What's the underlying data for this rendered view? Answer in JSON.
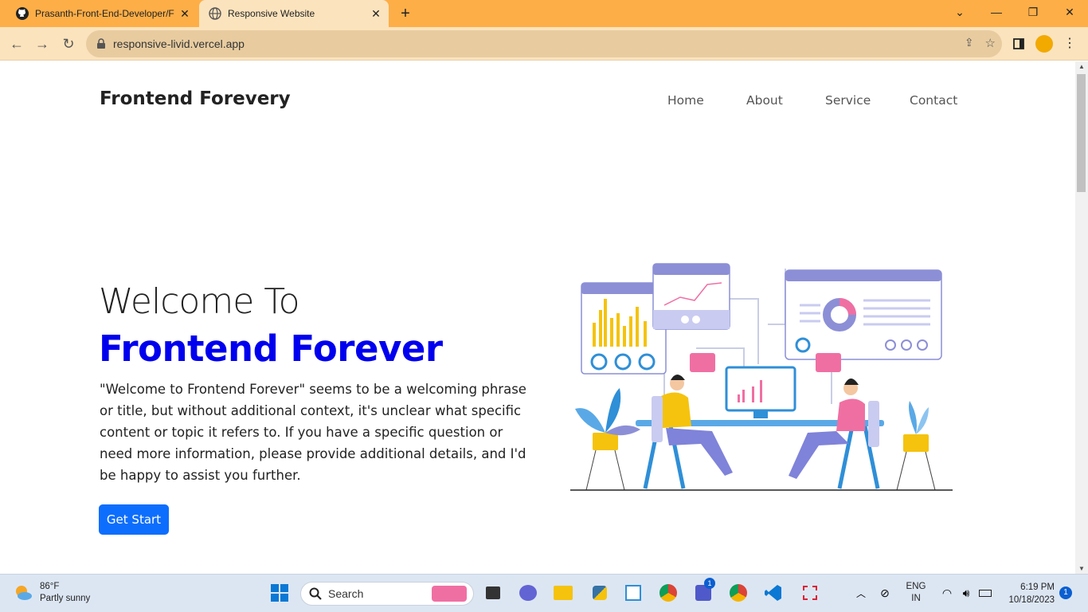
{
  "browser": {
    "tabs": [
      {
        "label": "Prasanth-Front-End-Developer/F",
        "icon": "github-icon",
        "active": false
      },
      {
        "label": "Responsive Website",
        "icon": "globe-icon",
        "active": true
      }
    ],
    "url": "responsive-livid.vercel.app"
  },
  "site": {
    "brand": "Frontend Forevery",
    "nav": [
      "Home",
      "About",
      "Service",
      "Contact"
    ],
    "hero": {
      "title_line1": "Welcome To",
      "title_line2": "Frontend Forever",
      "paragraph": "\"Welcome to Frontend Forever\" seems to be a welcoming phrase or title, but without additional context, it's unclear what specific content or topic it refers to. If you have a specific question or need more information, please provide additional details, and I'd be happy to assist you further.",
      "button": "Get Start"
    }
  },
  "taskbar": {
    "weather": {
      "temp": "86°F",
      "desc": "Partly sunny"
    },
    "search_placeholder": "Search",
    "language": {
      "line1": "ENG",
      "line2": "IN"
    },
    "time": "6:19 PM",
    "date": "10/18/2023",
    "notification_count": "1",
    "teams_badge": "1"
  },
  "colors": {
    "tabbar": "#fdae47",
    "accent_blue": "#0000ee",
    "button_blue": "#0d6efd"
  }
}
